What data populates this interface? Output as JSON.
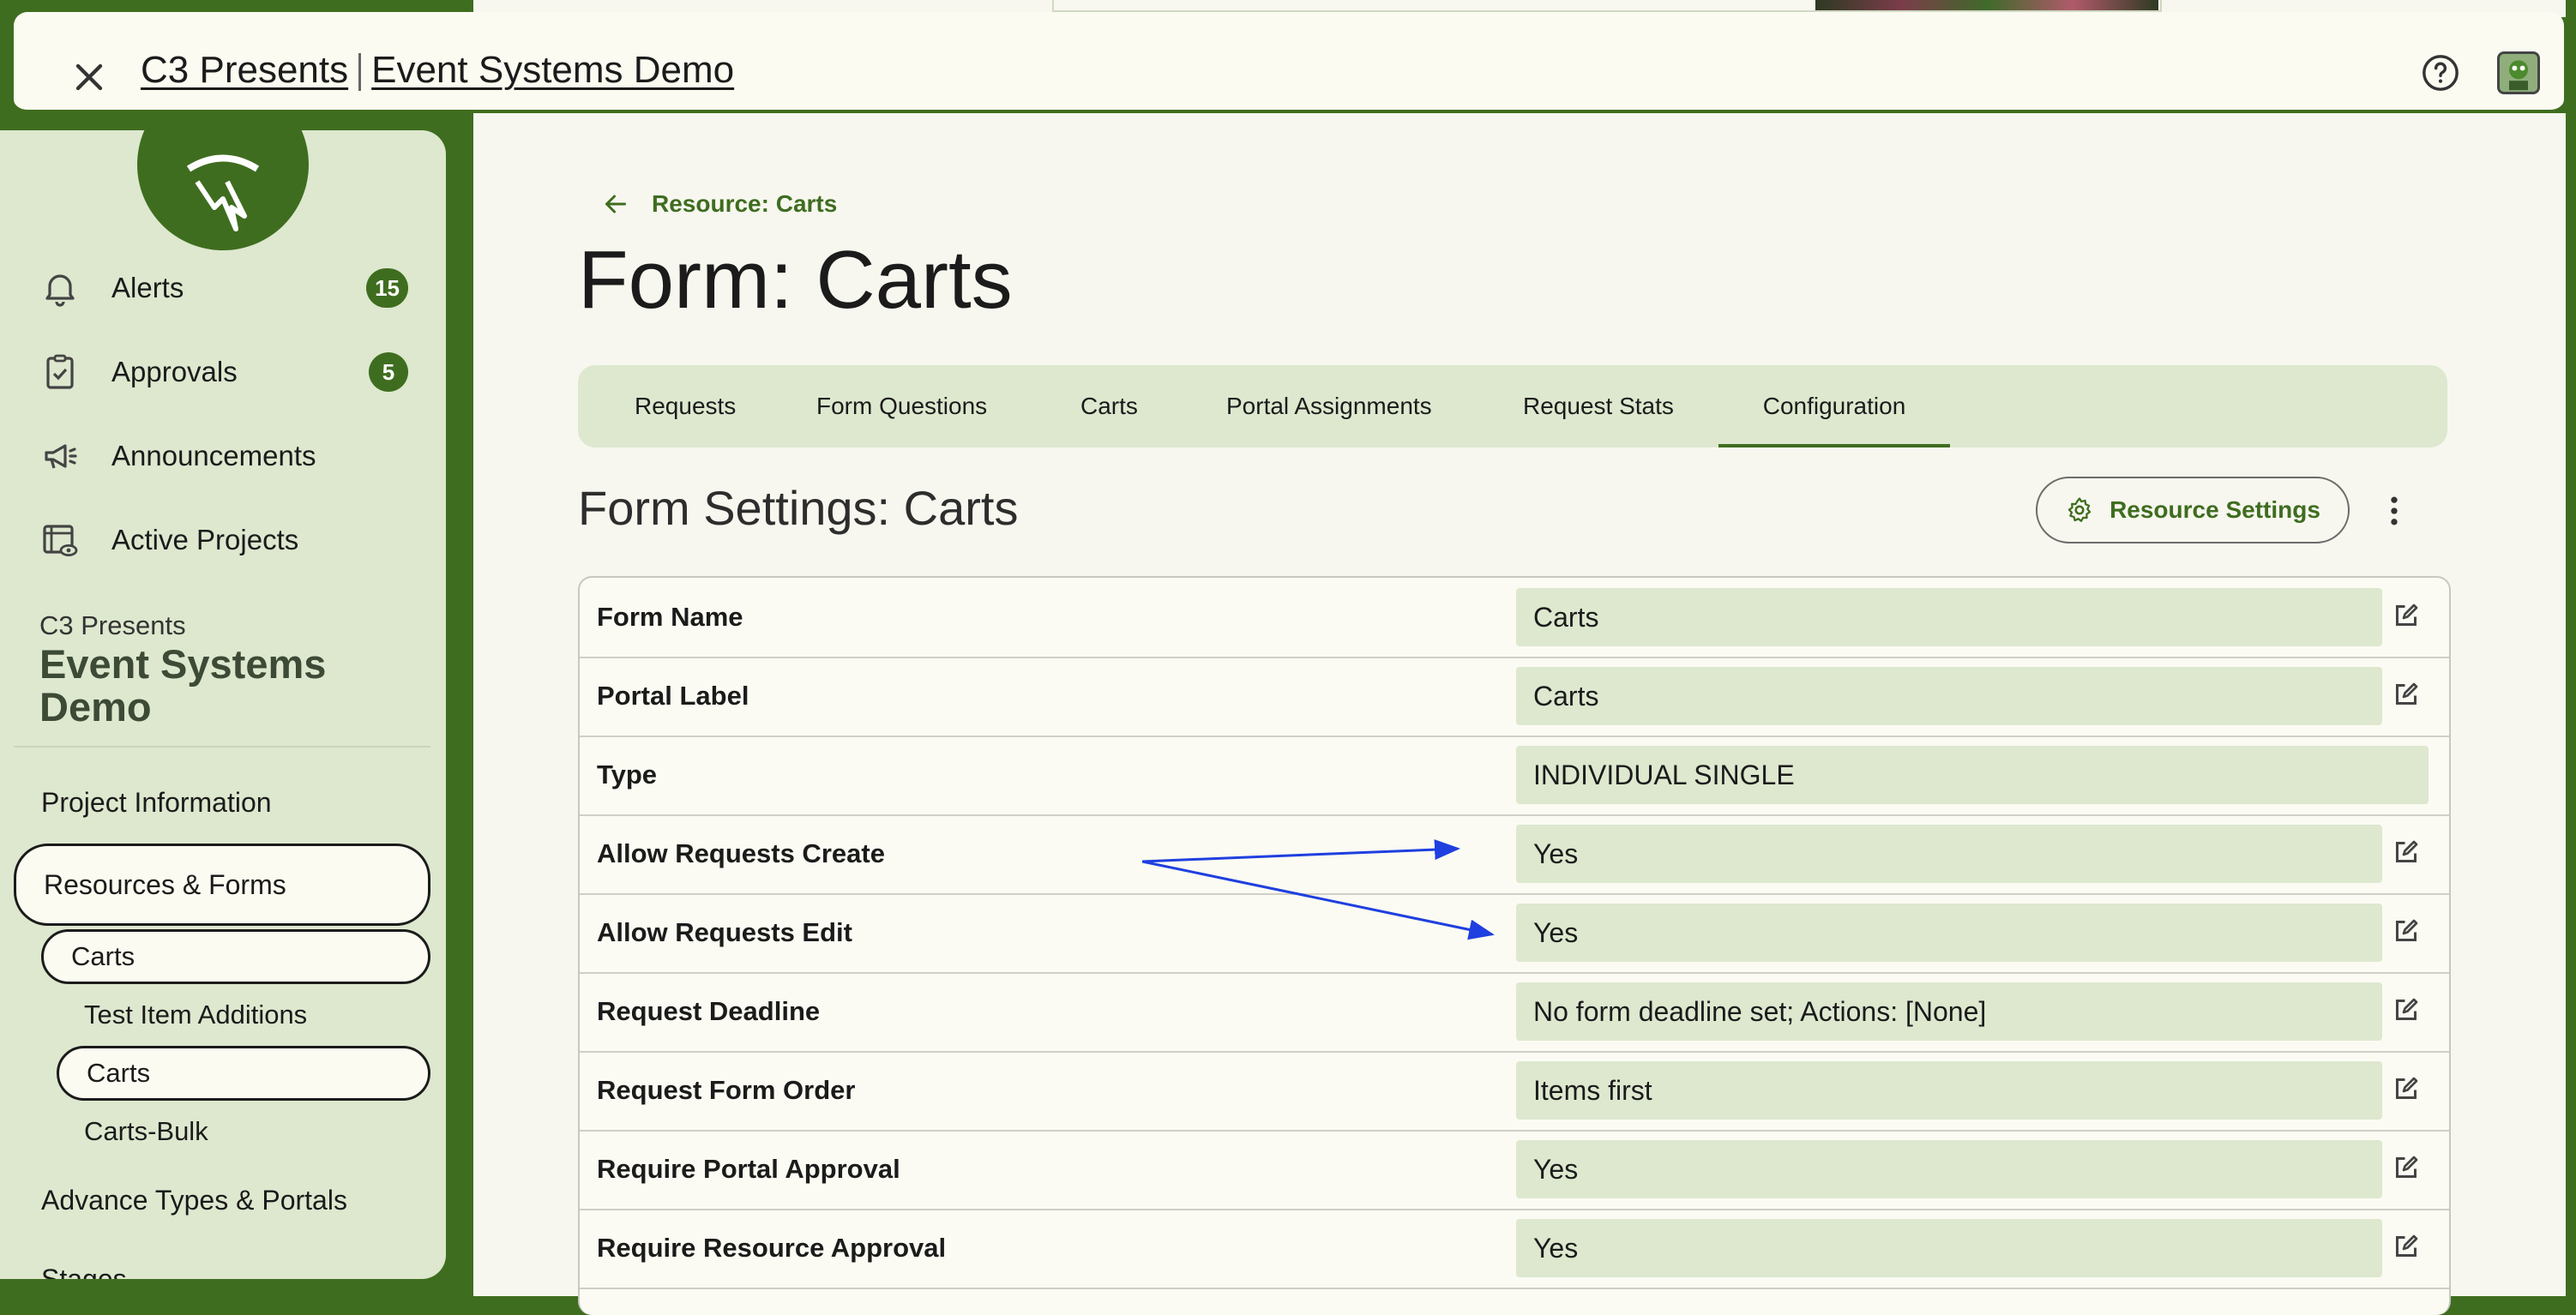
{
  "header": {
    "org_link": "C3 Presents",
    "project_link": "Event Systems Demo"
  },
  "sidebar": {
    "nav": [
      {
        "label": "Alerts",
        "badge": "15"
      },
      {
        "label": "Approvals",
        "badge": "5"
      },
      {
        "label": "Announcements"
      },
      {
        "label": "Active Projects"
      }
    ],
    "project_org": "C3 Presents",
    "project_name": "Event Systems Demo",
    "links": {
      "project_information": "Project Information",
      "resources_forms": "Resources & Forms",
      "carts": "Carts",
      "test_item_additions": "Test Item Additions",
      "carts_form": "Carts",
      "carts_bulk": "Carts-Bulk",
      "advance_types": "Advance Types & Portals",
      "stages": "Stages"
    }
  },
  "main": {
    "back_label": "Resource: Carts",
    "page_title": "Form: Carts",
    "tabs": [
      {
        "label": "Requests"
      },
      {
        "label": "Form Questions"
      },
      {
        "label": "Carts"
      },
      {
        "label": "Portal Assignments"
      },
      {
        "label": "Request Stats"
      },
      {
        "label": "Configuration",
        "active": true
      }
    ],
    "section_title": "Form Settings: Carts",
    "resource_settings_label": "Resource Settings",
    "settings": [
      {
        "key": "Form Name",
        "value": "Carts",
        "editable": true
      },
      {
        "key": "Portal Label",
        "value": "Carts",
        "editable": true
      },
      {
        "key": "Type",
        "value": "INDIVIDUAL SINGLE",
        "editable": false
      },
      {
        "key": "Allow Requests Create",
        "value": "Yes",
        "editable": true
      },
      {
        "key": "Allow Requests Edit",
        "value": "Yes",
        "editable": true
      },
      {
        "key": "Request Deadline",
        "value": "No form deadline set; Actions: [None]",
        "editable": true
      },
      {
        "key": "Request Form Order",
        "value": "Items first",
        "editable": true
      },
      {
        "key": "Require Portal Approval",
        "value": "Yes",
        "editable": true
      },
      {
        "key": "Require Resource Approval",
        "value": "Yes",
        "editable": true
      }
    ]
  },
  "colors": {
    "brand_green": "#3f6d1f",
    "light_green": "#dde8cf",
    "background": "#f7f7ef",
    "annotation_blue": "#1f3fe0"
  }
}
